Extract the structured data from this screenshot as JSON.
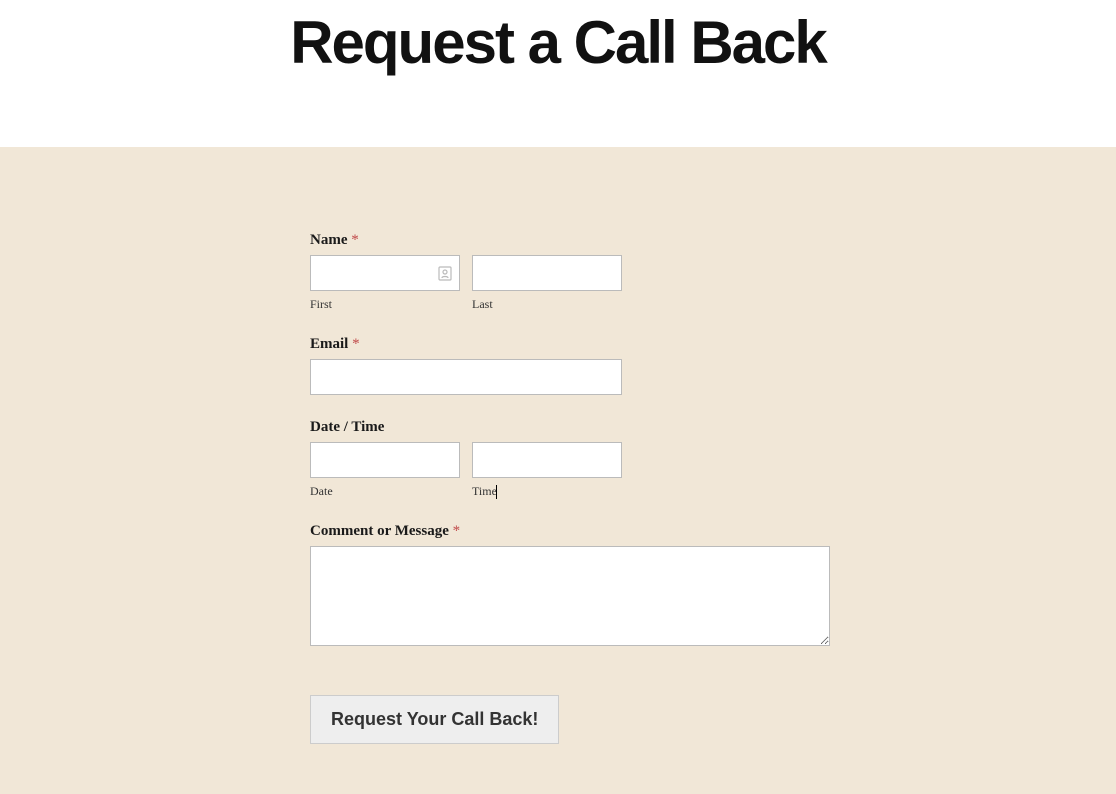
{
  "header": {
    "title": "Request a Call Back"
  },
  "form": {
    "name": {
      "label": "Name",
      "required": "*",
      "first_sublabel": "First",
      "last_sublabel": "Last",
      "first_value": "",
      "last_value": ""
    },
    "email": {
      "label": "Email",
      "required": "*",
      "value": ""
    },
    "datetime": {
      "label": "Date / Time",
      "date_sublabel": "Date",
      "time_sublabel": "Time",
      "date_value": "",
      "time_value": ""
    },
    "comment": {
      "label": "Comment or Message",
      "required": "*",
      "value": ""
    },
    "submit": {
      "label": "Request Your Call Back!"
    }
  }
}
